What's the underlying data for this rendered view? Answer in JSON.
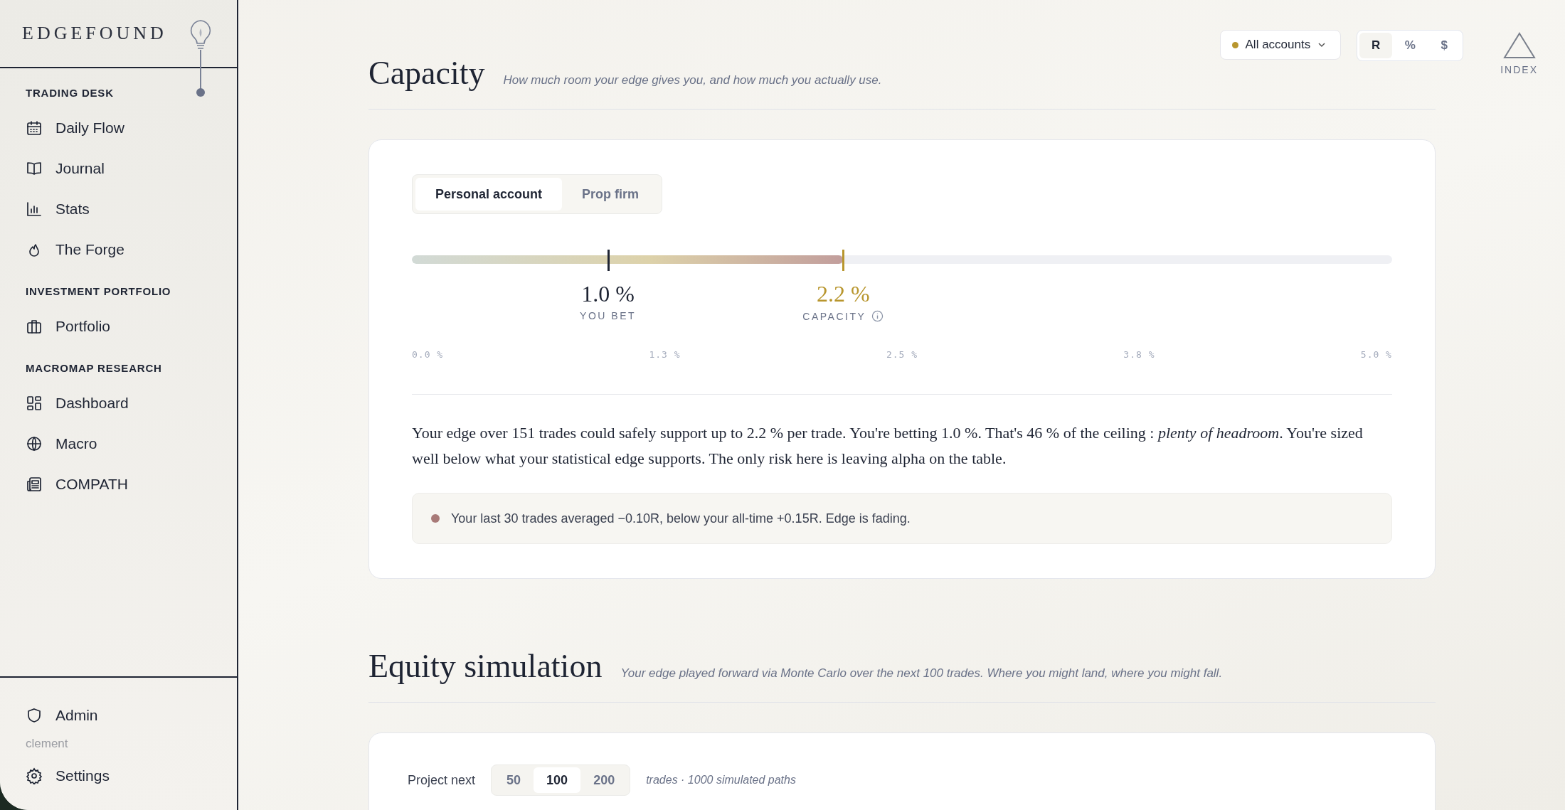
{
  "brand": "EDGEFOUND",
  "sidebar": {
    "sections": [
      {
        "heading": "TRADING DESK",
        "items": [
          "Daily Flow",
          "Journal",
          "Stats",
          "The Forge"
        ]
      },
      {
        "heading": "INVESTMENT PORTFOLIO",
        "items": [
          "Portfolio"
        ]
      },
      {
        "heading": "MACROMAP RESEARCH",
        "items": [
          "Dashboard",
          "Macro",
          "COMPATH"
        ]
      }
    ],
    "footer": {
      "admin": "Admin",
      "user": "clement",
      "settings": "Settings"
    }
  },
  "toolbar": {
    "account": "All accounts",
    "units": [
      {
        "label": "R",
        "selected": true
      },
      {
        "label": "%",
        "selected": false
      },
      {
        "label": "$",
        "selected": false
      }
    ],
    "index_label": "INDEX"
  },
  "capacity": {
    "title": "Capacity",
    "subtitle": "How much room your edge gives you, and how much you actually use.",
    "tabs": [
      {
        "label": "Personal account",
        "selected": true
      },
      {
        "label": "Prop firm",
        "selected": false
      }
    ],
    "meter": {
      "level": 0.44
    },
    "markers": [
      {
        "kind": "bet",
        "value": "1.0 %",
        "label": "YOU BET",
        "level": 0.2
      },
      {
        "kind": "capacity",
        "value": "2.2 %",
        "label": "CAPACITY",
        "level": 0.44
      }
    ],
    "ticks": [
      "0.0 %",
      "1.3 %",
      "2.5 %",
      "3.8 %",
      "5.0 %"
    ],
    "summary": "Your edge over 151 trades could safely support up to 2.2 % per trade. You're betting 1.0 %. That's 46 % of the ceiling : *plenty of headroom*. You're sized well below what your statistical edge supports. The only risk here is leaving alpha on the table.",
    "alert": "Your last 30 trades averaged −0.10R, below your all-time +0.15R. Edge is fading."
  },
  "equity": {
    "title": "Equity simulation",
    "subtitle": "Your edge played forward via Monte Carlo over the next 100 trades. Where you might land, where you might fall.",
    "project_label": "Project next",
    "options": [
      {
        "label": "50",
        "selected": false
      },
      {
        "label": "100",
        "selected": true
      },
      {
        "label": "200",
        "selected": false
      }
    ],
    "note": "trades · 1000 simulated paths"
  }
}
